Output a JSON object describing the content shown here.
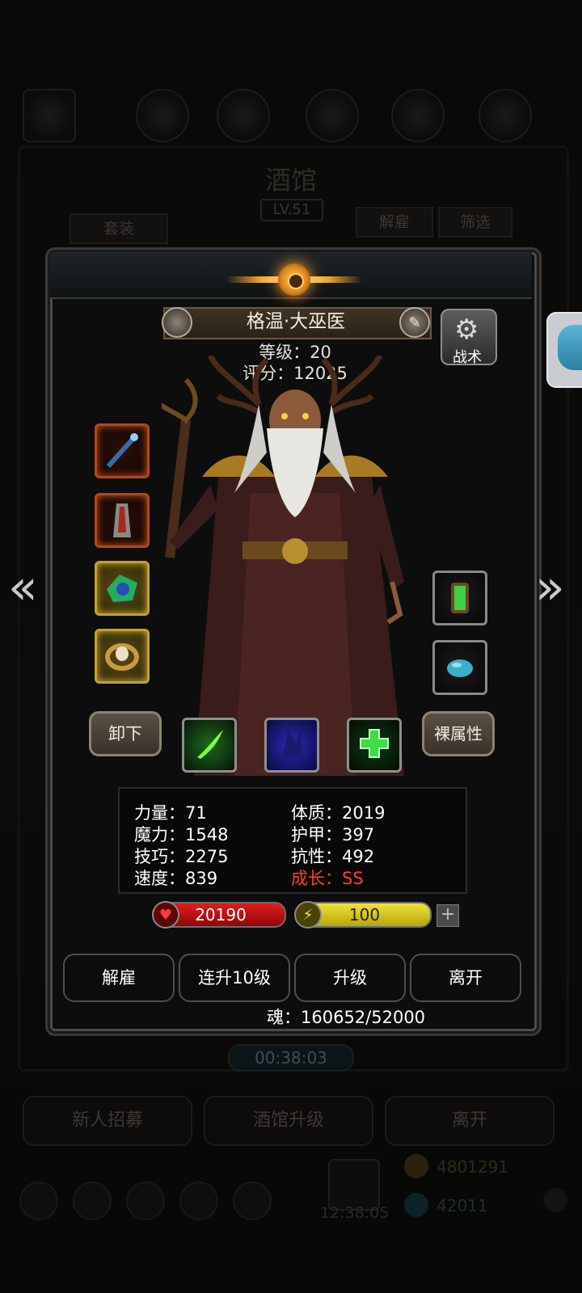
{
  "background": {
    "title": "酒馆",
    "level": "LV.51",
    "suit_button": "套装",
    "dismiss_button": "解雇",
    "filter_button": "筛选",
    "timer": "00:38:03",
    "recruit_button": "新人招募",
    "upgrade_tavern_button": "酒馆升级",
    "leave_button": "离开",
    "gold": "4801291",
    "gems": "42011",
    "clock": "12:38:05"
  },
  "hero": {
    "name": "格温·大巫医",
    "level_text": "等级：20",
    "score_text": "评分：12025"
  },
  "tactics_label": "战术",
  "equipment": {
    "left_slots": [
      "staff",
      "robe",
      "jade-emblem",
      "gold-ring"
    ],
    "right_slots": [
      "green-lantern",
      "blue-gem"
    ]
  },
  "actions": {
    "unequip": "卸下",
    "base_attributes": "裸属性"
  },
  "skills": [
    "green-claw-skill",
    "blue-shadow-skill",
    "green-cross-skill"
  ],
  "stats": {
    "strength": "力量：71",
    "magic": "魔力：1548",
    "skill": "技巧：2275",
    "speed": "速度：839",
    "constitution": "体质：2019",
    "armor": "护甲：397",
    "resistance": "抗性：492",
    "growth": "成长：SS"
  },
  "vitals": {
    "hp": "20190",
    "energy": "100",
    "plus": "+"
  },
  "buttons": {
    "dismiss": "解雇",
    "level_up_10": "连升10级",
    "level_up": "升级",
    "leave": "离开"
  },
  "soul": "魂：160652/52000",
  "colors": {
    "growth": "#ff3e2c",
    "hp": "#e21c1c",
    "energy": "#efe23b",
    "gold_frame": "#c2a12d",
    "red_frame": "#b6441e"
  }
}
